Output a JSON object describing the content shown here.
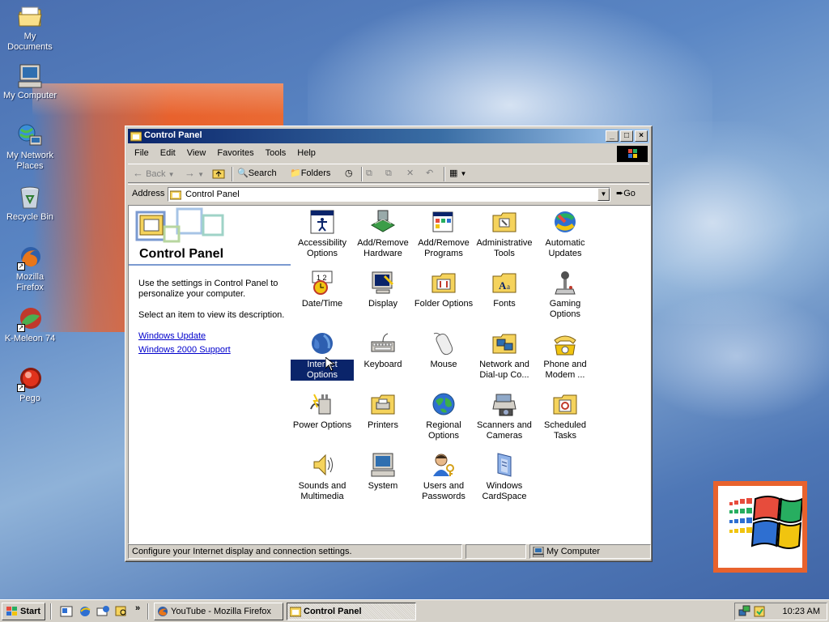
{
  "desktop": {
    "icons": [
      {
        "label": "My Documents"
      },
      {
        "label": "My Computer"
      },
      {
        "label": "My Network Places"
      },
      {
        "label": "Recycle Bin"
      },
      {
        "label": "Mozilla Firefox"
      },
      {
        "label": "K-Meleon 74"
      },
      {
        "label": "Pego"
      }
    ]
  },
  "window": {
    "title": "Control Panel",
    "menu": [
      "File",
      "Edit",
      "View",
      "Favorites",
      "Tools",
      "Help"
    ],
    "toolbar": {
      "back": "Back",
      "search": "Search",
      "folders": "Folders"
    },
    "address": {
      "label": "Address",
      "value": "Control Panel",
      "go": "Go"
    },
    "left_pane": {
      "heading": "Control Panel",
      "description": "Use the settings in Control Panel to personalize your computer.",
      "hint": "Select an item to view its description.",
      "links": [
        "Windows Update",
        "Windows 2000 Support"
      ]
    },
    "items": [
      "Accessibility Options",
      "Add/Remove Hardware",
      "Add/Remove Programs",
      "Administrative Tools",
      "Automatic Updates",
      "Date/Time",
      "Display",
      "Folder Options",
      "Fonts",
      "Gaming Options",
      "Internet Options",
      "Keyboard",
      "Mouse",
      "Network and Dial-up Co...",
      "Phone and Modem ...",
      "Power Options",
      "Printers",
      "Regional Options",
      "Scanners and Cameras",
      "Scheduled Tasks",
      "Sounds and Multimedia",
      "System",
      "Users and Passwords",
      "Windows CardSpace"
    ],
    "selected_item": "Internet Options",
    "status": {
      "text": "Configure your Internet display and connection settings.",
      "zone": "My Computer"
    }
  },
  "taskbar": {
    "start": "Start",
    "buttons": [
      "YouTube - Mozilla Firefox",
      "Control Panel"
    ],
    "clock": "10:23 AM"
  }
}
